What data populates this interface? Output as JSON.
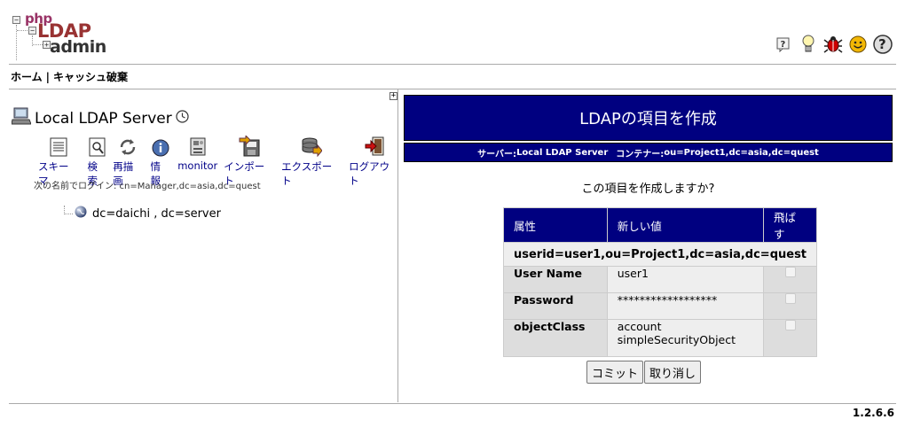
{
  "logo": {
    "line1": "php",
    "line2": "LDAP",
    "line3": "admin"
  },
  "header_icons": [
    "help-icon",
    "lightbulb-icon",
    "bug-icon",
    "smiley-icon",
    "question-icon"
  ],
  "menu": {
    "home": "ホーム",
    "separator": "|",
    "purge_cache": "キャッシュ破棄"
  },
  "server": {
    "name": "Local LDAP Server",
    "tools": [
      {
        "label": "スキーマ",
        "icon": "schema-icon"
      },
      {
        "label": "検索",
        "icon": "search-icon"
      },
      {
        "label": "再描画",
        "icon": "refresh-icon"
      },
      {
        "label": "情報",
        "icon": "info-icon"
      },
      {
        "label": "monitor",
        "icon": "monitor-icon"
      },
      {
        "label": "インポート",
        "icon": "import-icon"
      },
      {
        "label": "エクスポート",
        "icon": "export-icon"
      },
      {
        "label": "ログアウト",
        "icon": "logout-icon"
      }
    ],
    "login_text": "次の名前でログイン: cn=Manager,dc=asia,dc=quest",
    "tree_entry": "dc=daichi , dc=server"
  },
  "create": {
    "title": "LDAPの項目を作成",
    "server_label": "サーバー: ",
    "server_value": "Local LDAP Server",
    "container_label": "コンテナー: ",
    "container_value": "ou=Project1,dc=asia,dc=quest",
    "question": "この項目を作成しますか?",
    "headers": {
      "attr": "属性",
      "value": "新しい値",
      "skip": "飛ばす"
    },
    "dn": "userid=user1,ou=Project1,dc=asia,dc=quest",
    "rows": [
      {
        "name": "User Name",
        "value": "user1",
        "value2": ""
      },
      {
        "name": "Password",
        "value": "******************",
        "value2": ""
      },
      {
        "name": "objectClass",
        "value": "account",
        "value2": "simpleSecurityObject"
      }
    ],
    "commit": "コミット",
    "cancel": "取り消し"
  },
  "version": "1.2.6.6"
}
